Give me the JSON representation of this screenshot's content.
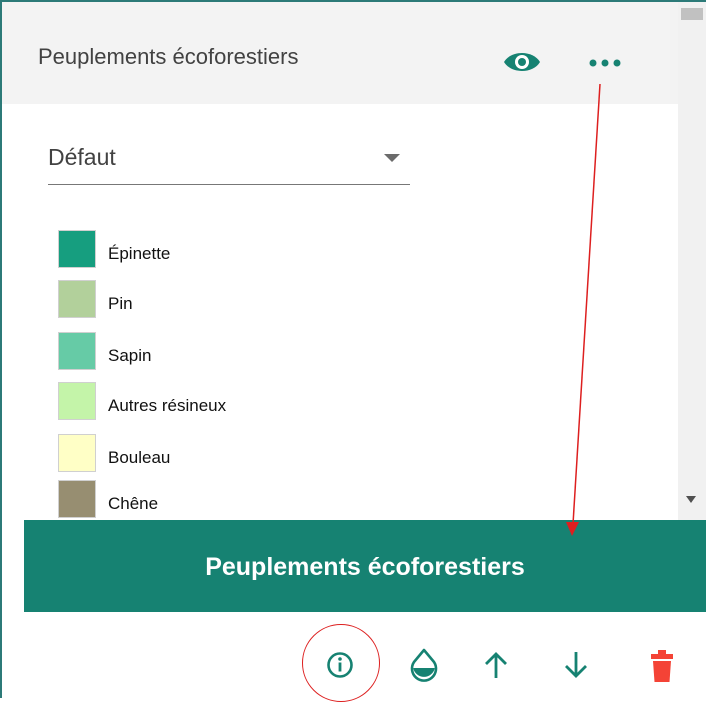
{
  "panel": {
    "title": "Peuplements écoforestiers"
  },
  "header_icons": {
    "visibility": "eye-icon",
    "menu": "more-horizontal-icon"
  },
  "style_select": {
    "value": "Défaut"
  },
  "legend": {
    "items": [
      {
        "label": "Épinette",
        "color": "#169e7f"
      },
      {
        "label": "Pin",
        "color": "#b2d09b"
      },
      {
        "label": "Sapin",
        "color": "#66cba6"
      },
      {
        "label": "Autres résineux",
        "color": "#c4f4a9"
      },
      {
        "label": "Bouleau",
        "color": "#ffffc6"
      },
      {
        "label": "Chêne",
        "color": "#978e71"
      }
    ]
  },
  "banner": {
    "title": "Peuplements écoforestiers",
    "color": "#168272"
  },
  "toolbar": {
    "buttons": [
      {
        "name": "info-button",
        "icon": "info-icon"
      },
      {
        "name": "opacity-button",
        "icon": "opacity-icon"
      },
      {
        "name": "move-up-button",
        "icon": "arrow-up-icon"
      },
      {
        "name": "move-down-button",
        "icon": "arrow-down-icon"
      },
      {
        "name": "delete-button",
        "icon": "trash-icon",
        "color": "#f44336"
      }
    ]
  },
  "colors": {
    "accent": "#168272",
    "annotation": "#dd1f1f"
  }
}
